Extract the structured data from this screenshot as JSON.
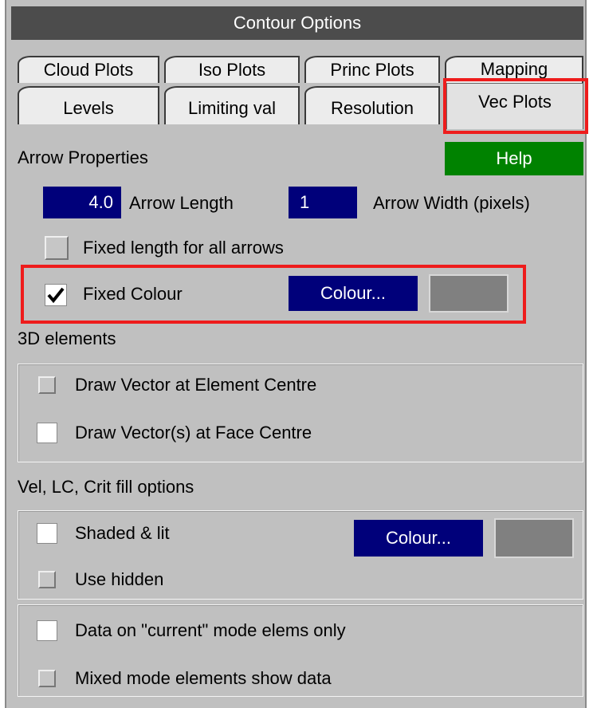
{
  "window_title": "Contour Options",
  "tabs": {
    "row1": [
      "Cloud Plots",
      "Iso Plots",
      "Princ Plots",
      "Mapping"
    ],
    "row2": [
      "Levels",
      "Limiting val",
      "Resolution"
    ],
    "active": "Vec Plots"
  },
  "arrow": {
    "section_label": "Arrow Properties",
    "help_label": "Help",
    "length_value": "4.0",
    "length_label": "Arrow Length",
    "width_value": "1",
    "width_label": "Arrow Width (pixels)",
    "fixed_length_label": "Fixed length for all arrows",
    "fixed_length_checked": false,
    "fixed_colour_label": "Fixed Colour",
    "fixed_colour_checked": true,
    "colour_button_label": "Colour...",
    "swatch_color": "#808080"
  },
  "elements3d": {
    "section_label": "3D elements",
    "draw_element_centre_label": "Draw Vector at Element Centre",
    "draw_face_centre_label": "Draw Vector(s) at Face Centre"
  },
  "fill": {
    "section_label": "Vel, LC, Crit fill options",
    "shaded_lit_label": "Shaded & lit",
    "colour_button_label": "Colour...",
    "use_hidden_label": "Use hidden",
    "swatch_color": "#808080"
  },
  "mode": {
    "current_mode_label": "Data on \"current\" mode elems only",
    "mixed_mode_label": "Mixed mode elements show data"
  },
  "colors": {
    "accent_navy": "#00007a",
    "help_green": "#008200",
    "highlight_red": "#ee1c1c",
    "panel_grey": "#c0c0c0"
  }
}
